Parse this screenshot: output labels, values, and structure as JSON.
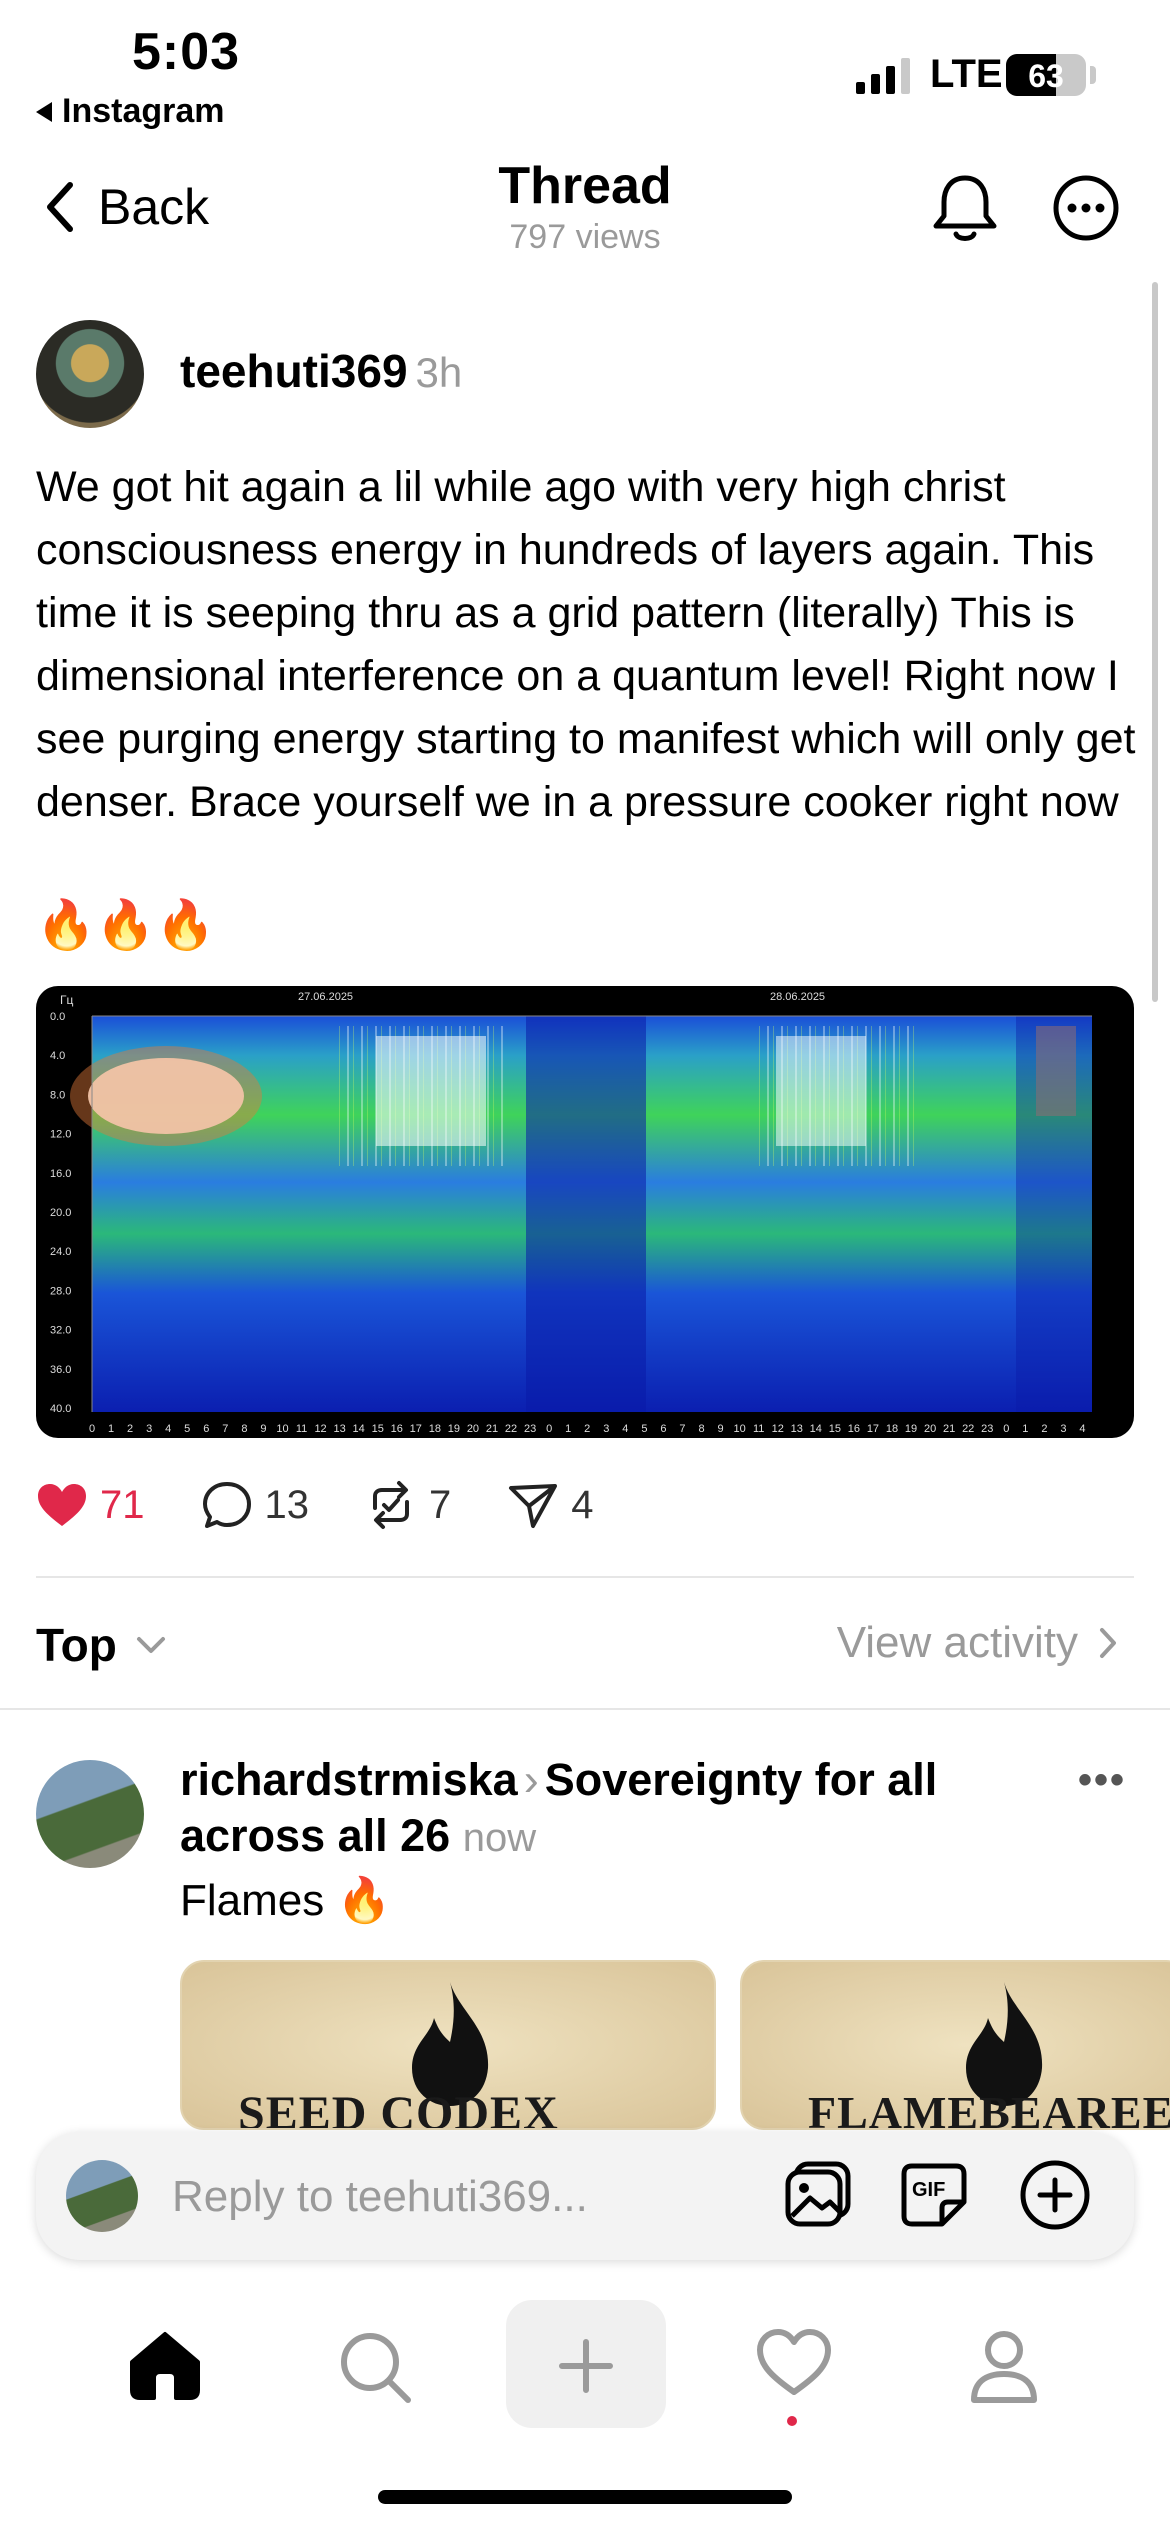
{
  "status": {
    "time": "5:03",
    "back_app": "Instagram",
    "network": "LTE",
    "battery": "63",
    "battery_level": 0.63
  },
  "nav": {
    "back_label": "Back",
    "title": "Thread",
    "views": "797 views"
  },
  "post": {
    "author": "teehuti369",
    "time_ago": "3h",
    "text": "We got hit again a lil while ago with very high christ consciousness energy in hundreds of layers again. This time it is seeping thru as a grid pattern (literally) This is dimensional interference on a quantum level! Right now I see purging energy starting to manifest which will only get denser. Brace yourself we in a pressure cooker right now",
    "emojis": "🔥🔥🔥",
    "image": {
      "unit_label": "Гц",
      "date_labels": [
        "27.06.2025",
        "28.06.2025"
      ],
      "y_labels": [
        "0.0",
        "4.0",
        "8.0",
        "12.0",
        "16.0",
        "20.0",
        "24.0",
        "28.0",
        "32.0",
        "36.0",
        "40.0"
      ],
      "x_labels": [
        "0",
        "1",
        "2",
        "3",
        "4",
        "5",
        "6",
        "7",
        "8",
        "9",
        "10",
        "11",
        "12",
        "13",
        "14",
        "15",
        "16",
        "17",
        "18",
        "19",
        "20",
        "21",
        "22",
        "23",
        "0",
        "1",
        "2",
        "3",
        "4",
        "5",
        "6",
        "7",
        "8",
        "9",
        "10",
        "11",
        "12",
        "13",
        "14",
        "15",
        "16",
        "17",
        "18",
        "19",
        "20",
        "21",
        "22",
        "23",
        "0",
        "1",
        "2",
        "3",
        "4"
      ]
    },
    "likes": "71",
    "comments": "13",
    "reposts": "7",
    "shares": "4"
  },
  "sort": {
    "label": "Top",
    "view_activity": "View activity"
  },
  "reply": {
    "author": "richardstrmiska",
    "community": "Sovereignty for all across all 26",
    "time_ago": "now",
    "text": "Flames",
    "emoji": "🔥",
    "cards": [
      "SEED CODEX",
      "FLAMEBEAREE"
    ]
  },
  "composer": {
    "placeholder": "Reply to teehuti369..."
  },
  "tabs": [
    "home-icon",
    "search-icon",
    "create-icon",
    "activity-icon",
    "profile-icon"
  ]
}
